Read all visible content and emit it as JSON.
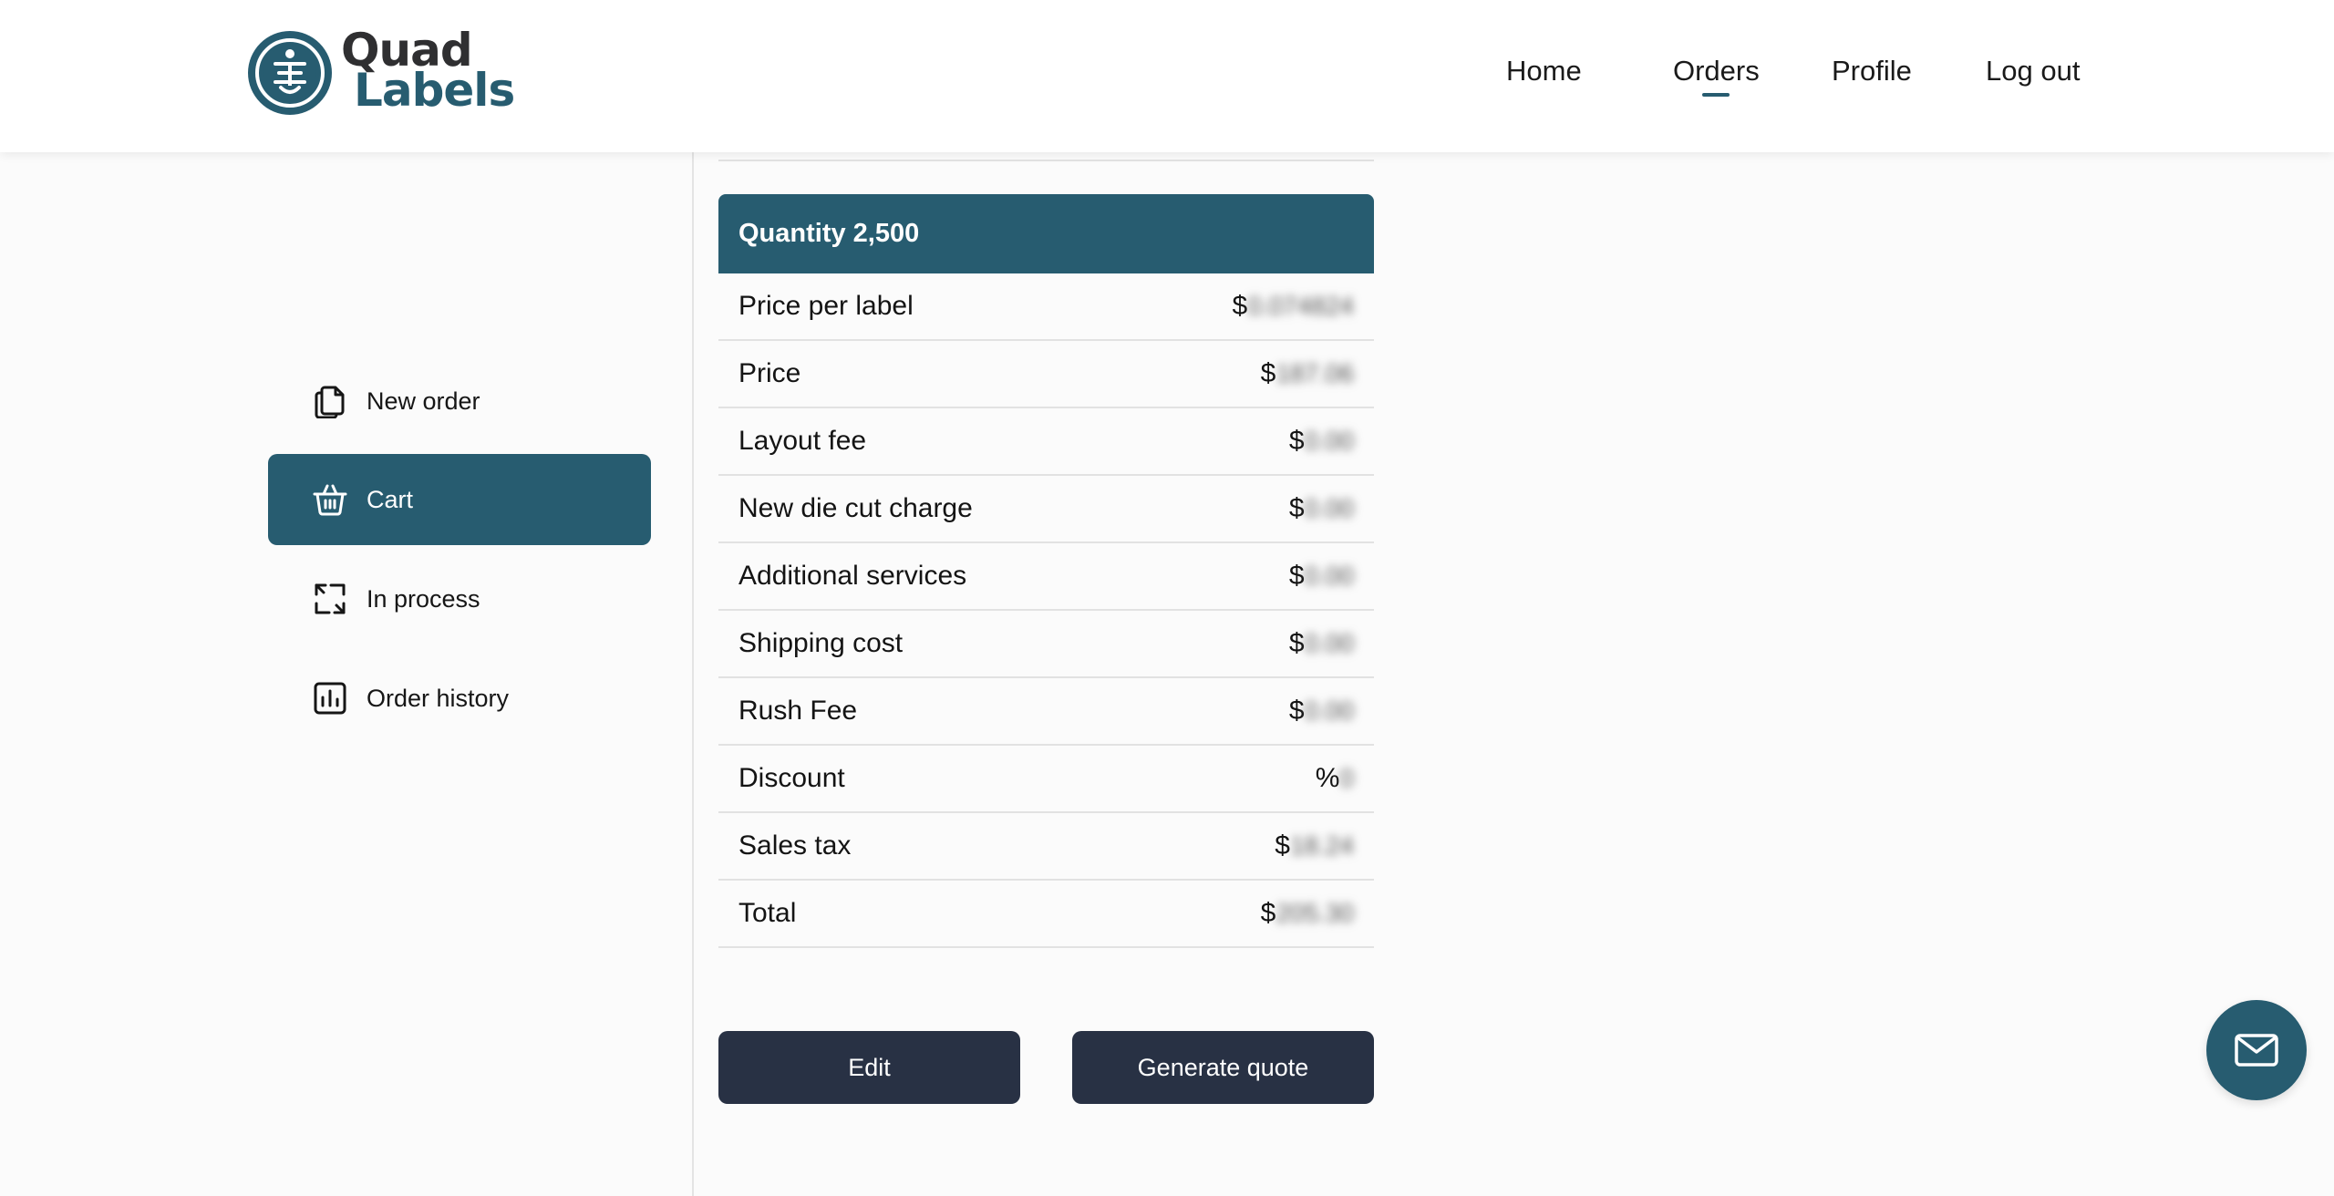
{
  "brand": {
    "name_line1": "Quad",
    "name_line2": "Labels",
    "primary_color": "#275c70",
    "dark_color": "#283144"
  },
  "nav": {
    "items": [
      {
        "label": "Home"
      },
      {
        "label": "Orders",
        "active": true
      },
      {
        "label": "Profile"
      },
      {
        "label": "Log out"
      }
    ]
  },
  "sidebar": {
    "items": [
      {
        "label": "New order",
        "icon": "document-copy-icon"
      },
      {
        "label": "Cart",
        "icon": "basket-icon",
        "active": true
      },
      {
        "label": "In process",
        "icon": "refresh-arrows-icon"
      },
      {
        "label": "Order history",
        "icon": "bar-chart-icon"
      }
    ]
  },
  "pricing": {
    "header": "Quantity 2,500",
    "rows": [
      {
        "label": "Price per label",
        "symbol": "$",
        "value": "0.074824"
      },
      {
        "label": "Price",
        "symbol": "$",
        "value": "187.06"
      },
      {
        "label": "Layout fee",
        "symbol": "$",
        "value": "0.00"
      },
      {
        "label": "New die cut charge",
        "symbol": "$",
        "value": "0.00"
      },
      {
        "label": "Additional services",
        "symbol": "$",
        "value": "0.00"
      },
      {
        "label": "Shipping cost",
        "symbol": "$",
        "value": "0.00"
      },
      {
        "label": "Rush Fee",
        "symbol": "$",
        "value": "0.00"
      },
      {
        "label": "Discount",
        "symbol": "%",
        "value": "0"
      },
      {
        "label": "Sales tax",
        "symbol": "$",
        "value": "18.24"
      },
      {
        "label": "Total",
        "symbol": "$",
        "value": "205.30"
      }
    ]
  },
  "actions": {
    "edit_label": "Edit",
    "generate_label": "Generate quote"
  },
  "fab": {
    "icon": "mail-icon"
  }
}
